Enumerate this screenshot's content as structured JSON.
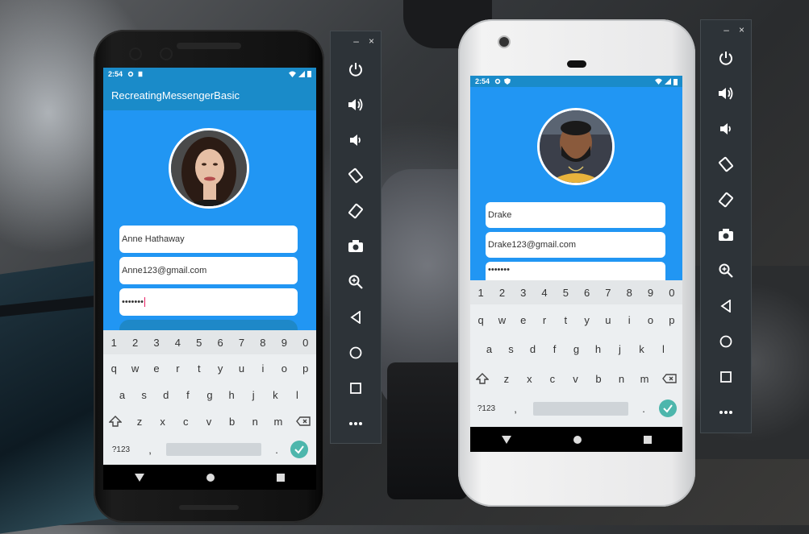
{
  "left_phone": {
    "status_time": "2:54",
    "app_title": "RecreatingMessengerBasic",
    "name_value": "Anne Hathaway",
    "email_value": "Anne123@gmail.com",
    "password_value": "•••••••"
  },
  "right_phone": {
    "status_time": "2:54",
    "name_value": "Drake",
    "email_value": "Drake123@gmail.com",
    "password_value": "•••••••"
  },
  "keyboard": {
    "number_row": [
      "1",
      "2",
      "3",
      "4",
      "5",
      "6",
      "7",
      "8",
      "9",
      "0"
    ],
    "row1": [
      "q",
      "w",
      "e",
      "r",
      "t",
      "y",
      "u",
      "i",
      "o",
      "p"
    ],
    "row2": [
      "a",
      "s",
      "d",
      "f",
      "g",
      "h",
      "j",
      "k",
      "l"
    ],
    "row3": [
      "z",
      "x",
      "c",
      "v",
      "b",
      "n",
      "m"
    ],
    "symbols_key": "?123",
    "comma_key": ",",
    "period_key": "."
  },
  "toolbar_left": {
    "minimize": "–",
    "close": "×",
    "buttons": [
      "power-icon",
      "volume-up-icon",
      "volume-down-icon",
      "rotate-left-icon",
      "rotate-right-icon",
      "camera-icon",
      "zoom-icon",
      "back-icon",
      "home-icon",
      "overview-icon",
      "more-icon"
    ]
  },
  "toolbar_right": {
    "minimize": "–",
    "close": "×"
  },
  "colors": {
    "app_blue": "#2196f3",
    "appbar_blue": "#1a8bc9",
    "keyboard_bg": "#eceff1",
    "enter_key": "#4db6ac",
    "toolbar_bg": "#2d3338"
  }
}
